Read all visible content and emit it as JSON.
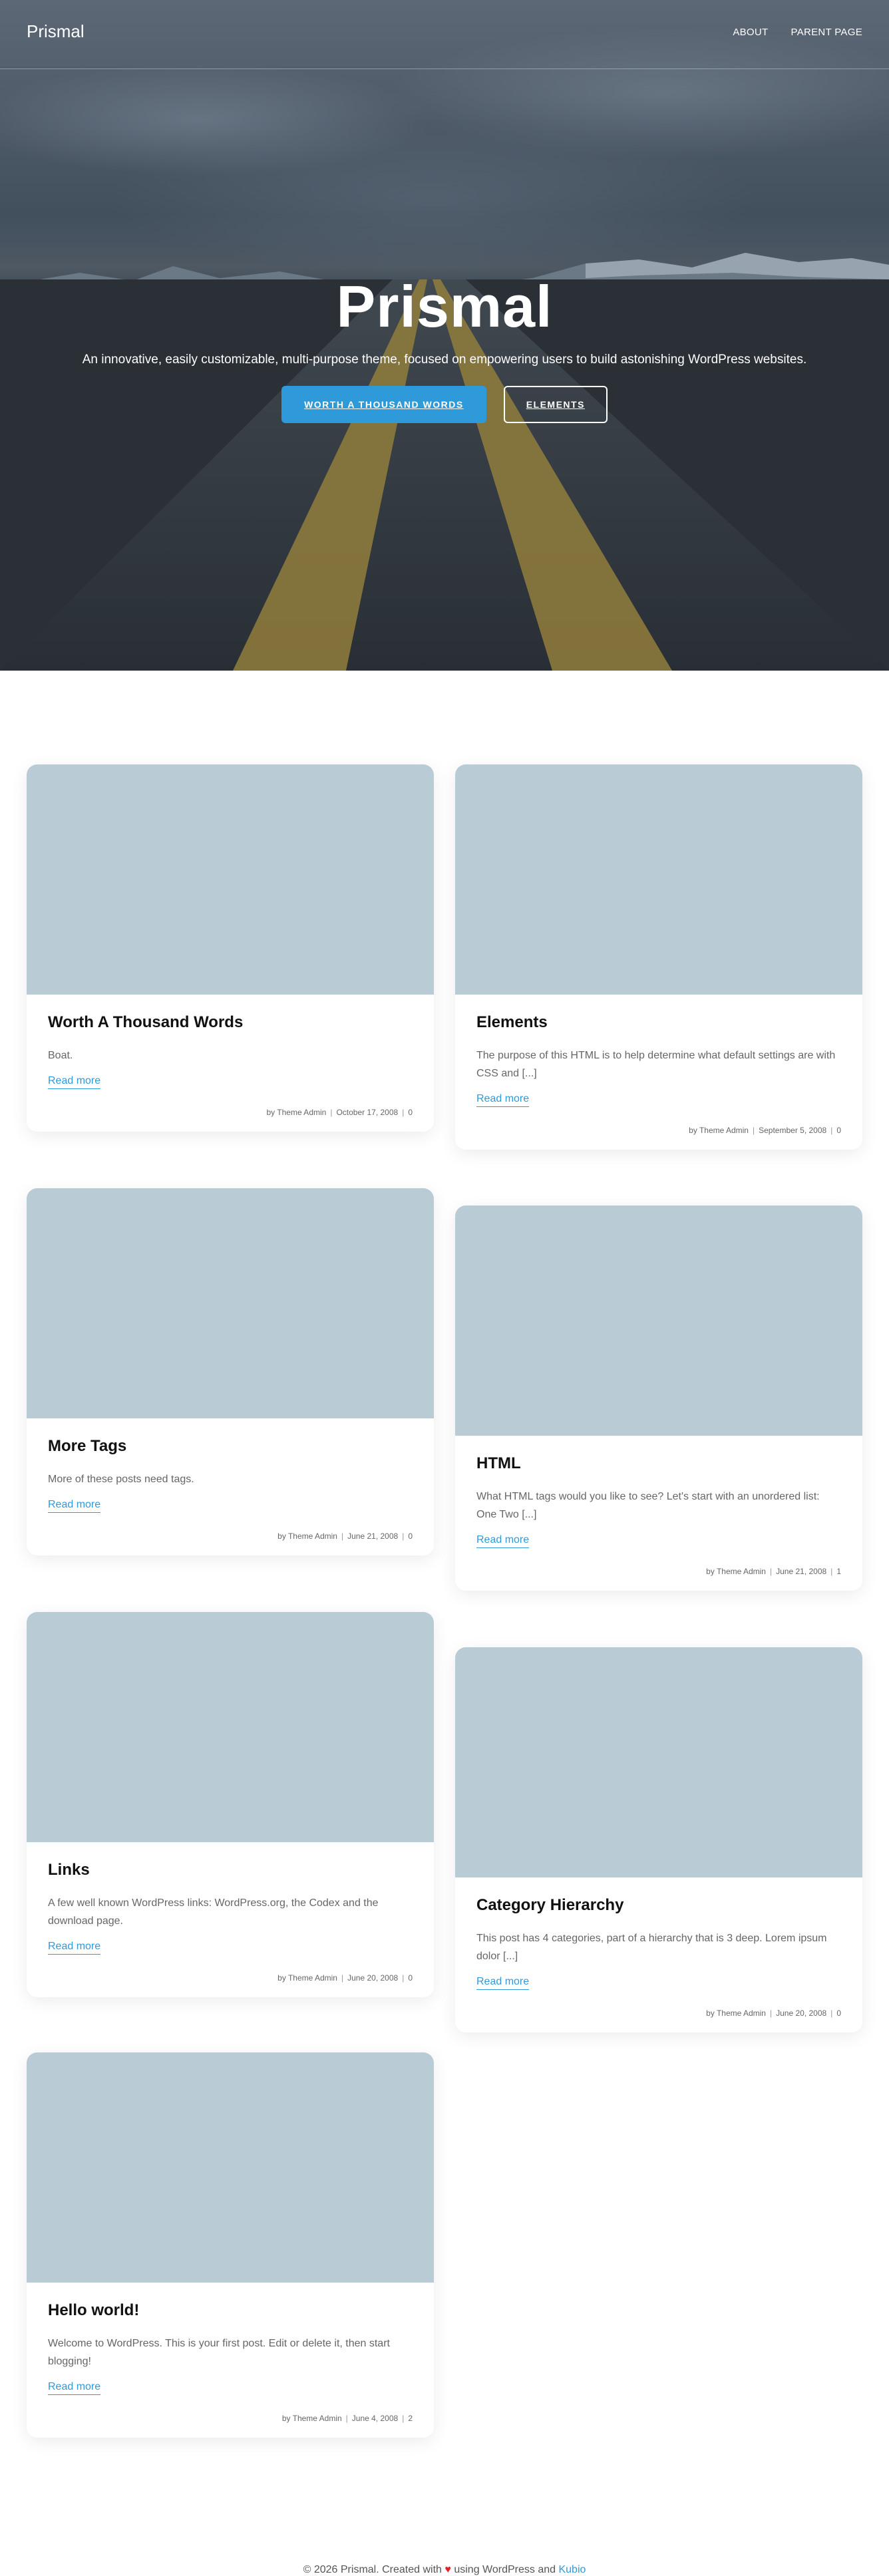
{
  "site": {
    "logo": "Prismal",
    "nav": [
      {
        "label": "ABOUT"
      },
      {
        "label": "PARENT PAGE"
      }
    ]
  },
  "hero": {
    "title": "Prismal",
    "subtitle": "An innovative, easily customizable, multi-purpose theme, focused on empowering users to build astonishing WordPress websites.",
    "primary_button": "WORTH A THOUSAND WORDS",
    "secondary_button": "ELEMENTS"
  },
  "posts": [
    {
      "title": "Worth A Thousand Words",
      "excerpt": "Boat.",
      "read_more": "Read more",
      "author": "by Theme Admin",
      "date": "October 17, 2008",
      "comments": "0"
    },
    {
      "title": "Elements",
      "excerpt": "The purpose of this HTML is to help determine what default settings are with CSS and [...]",
      "read_more": "Read more",
      "author": "by Theme Admin",
      "date": "September 5, 2008",
      "comments": "0"
    },
    {
      "title": "More Tags",
      "excerpt": "More of these posts need tags.",
      "read_more": "Read more",
      "author": "by Theme Admin",
      "date": "June 21, 2008",
      "comments": "0"
    },
    {
      "title": "HTML",
      "excerpt": "What HTML tags would you like to see? Let's start with an unordered list: One Two [...]",
      "read_more": "Read more",
      "author": "by Theme Admin",
      "date": "June 21, 2008",
      "comments": "1"
    },
    {
      "title": "Links",
      "excerpt": "A few well known WordPress links: WordPress.org, the Codex and the download page.",
      "read_more": "Read more",
      "author": "by Theme Admin",
      "date": "June 20, 2008",
      "comments": "0"
    },
    {
      "title": "Category Hierarchy",
      "excerpt": "This post has 4 categories, part of a hierarchy that is 3 deep. Lorem ipsum dolor [...]",
      "read_more": "Read more",
      "author": "by Theme Admin",
      "date": "June 20, 2008",
      "comments": "0"
    },
    {
      "title": "Hello world!",
      "excerpt": "Welcome to WordPress. This is your first post. Edit or delete it, then start blogging!",
      "read_more": "Read more",
      "author": "by Theme Admin",
      "date": "June 4, 2008",
      "comments": "2"
    }
  ],
  "footer": {
    "prefix": "© 2026 Prismal. Created with",
    "heart": "♥",
    "middle": "using WordPress and",
    "link": "Kubio"
  },
  "colors": {
    "accent": "#2f9ad9",
    "image_placeholder": "#b9cbd5",
    "heart": "#e0202a"
  }
}
